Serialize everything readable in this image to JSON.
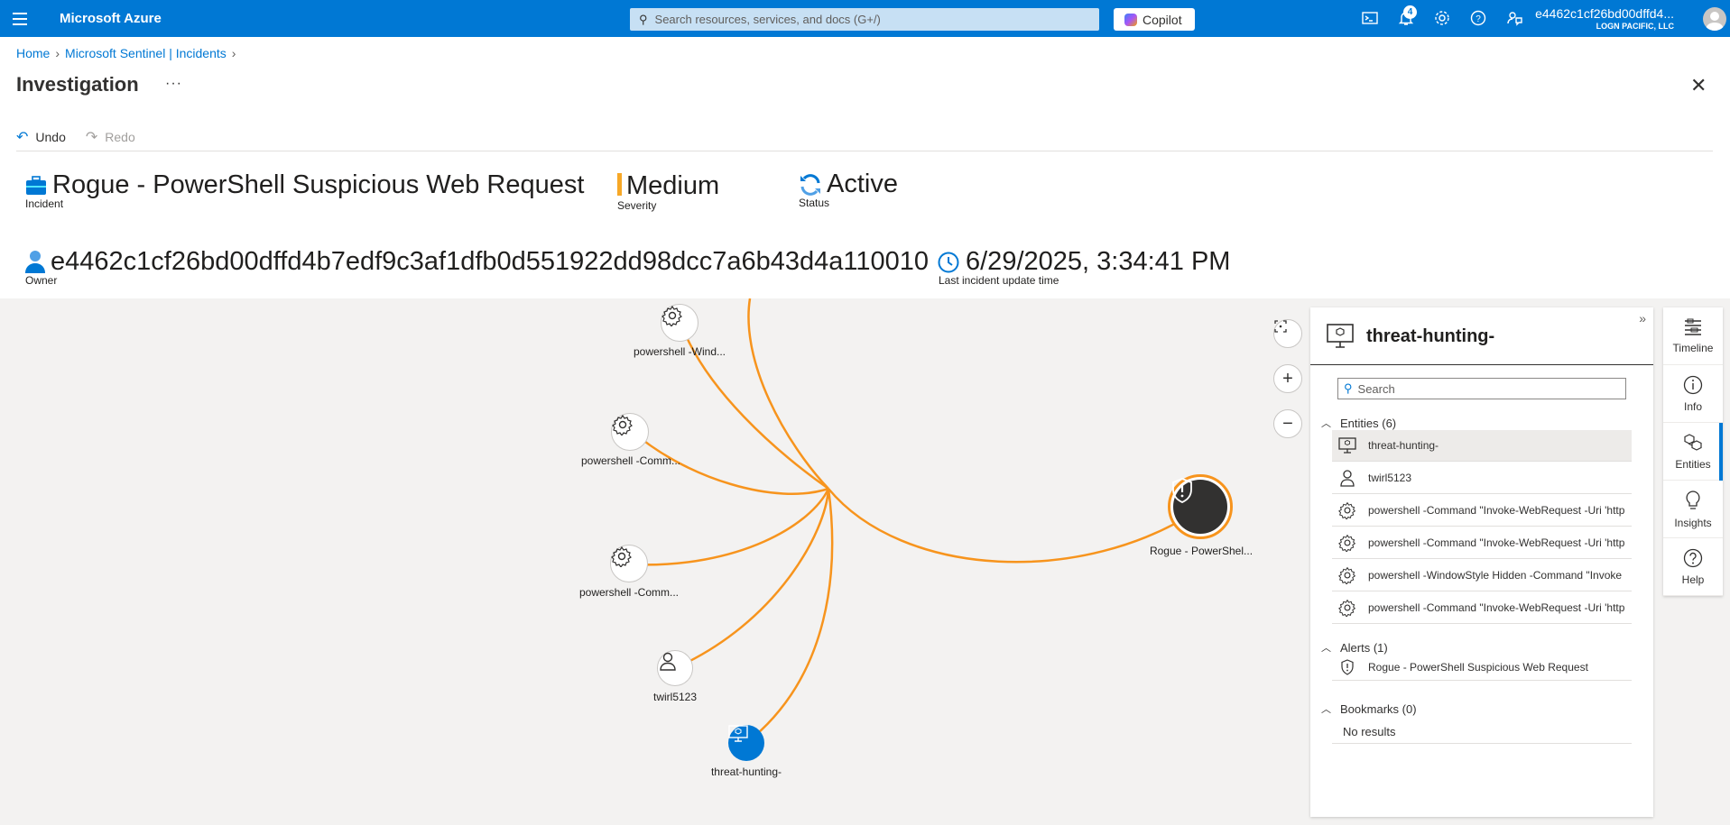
{
  "topbar": {
    "brand": "Microsoft Azure",
    "search_placeholder": "Search resources, services, and docs (G+/)",
    "copilot_label": "Copilot",
    "notification_count": "4",
    "account_name": "e4462c1cf26bd00dffd4...",
    "account_org": "LOGN PACIFIC, LLC"
  },
  "breadcrumb": {
    "home": "Home",
    "incidents": "Microsoft Sentinel | Incidents"
  },
  "page": {
    "title": "Investigation",
    "more": "···"
  },
  "commands": {
    "undo": "Undo",
    "redo": "Redo"
  },
  "summary": {
    "incident_title": "Rogue - PowerShell Suspicious Web Request",
    "incident_label": "Incident",
    "severity": "Medium",
    "severity_label": "Severity",
    "severity_color": "#f7a827",
    "status": "Active",
    "status_label": "Status",
    "owner": "e4462c1cf26bd00dffd4b7edf9c3af1dfb0d551922dd98dcc7a6b43d4a110010",
    "owner_label": "Owner",
    "updated": "6/29/2025, 3:34:41 PM",
    "updated_label": "Last incident update time"
  },
  "graph": {
    "edge_color": "#f7941d",
    "nodes": {
      "proc1": "powershell -Wind...",
      "proc2": "powershell -Comm...",
      "proc3": "powershell -Comm...",
      "user": "twirl5123",
      "host": "threat-hunting-",
      "alert": "Rogue - PowerShel..."
    }
  },
  "panel": {
    "title": "threat-hunting-",
    "search_placeholder": "Search",
    "entities_header": "Entities (6)",
    "entities": [
      {
        "icon": "computer-icon",
        "label": "threat-hunting-"
      },
      {
        "icon": "user-icon",
        "label": "twirl5123"
      },
      {
        "icon": "gear-icon",
        "label": "powershell -Command \"Invoke-WebRequest -Uri 'http"
      },
      {
        "icon": "gear-icon",
        "label": "powershell -Command \"Invoke-WebRequest -Uri 'http"
      },
      {
        "icon": "gear-icon",
        "label": "powershell -WindowStyle Hidden -Command \"Invoke"
      },
      {
        "icon": "gear-icon",
        "label": "powershell -Command \"Invoke-WebRequest -Uri 'http"
      }
    ],
    "alerts_header": "Alerts (1)",
    "alert_item": "Rogue - PowerShell Suspicious Web Request",
    "bookmarks_header": "Bookmarks (0)",
    "bookmarks_empty": "No results"
  },
  "rail": {
    "timeline": "Timeline",
    "info": "Info",
    "entities": "Entities",
    "insights": "Insights",
    "help": "Help"
  }
}
